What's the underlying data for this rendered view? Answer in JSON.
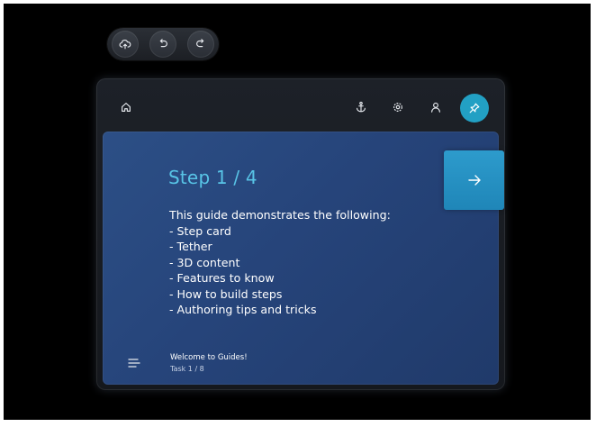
{
  "toolbar": {
    "buttons": [
      {
        "name": "cloud-upload",
        "icon": "cloud-upload-icon"
      },
      {
        "name": "undo",
        "icon": "undo-icon"
      },
      {
        "name": "redo",
        "icon": "redo-icon"
      }
    ]
  },
  "header": {
    "left_icon": "home-icon",
    "right_icons": [
      "anchor-icon",
      "settings-icon",
      "profile-icon"
    ],
    "pin_icon": "pin-icon",
    "accent_color": "#22a0c4"
  },
  "step": {
    "title": "Step 1 / 4",
    "body_lines": [
      "This guide demonstrates the following:",
      "- Step card",
      "- Tether",
      "- 3D content",
      "- Features to know",
      "- How to build steps",
      "- Authoring tips and tricks"
    ],
    "next_icon": "arrow-right-icon"
  },
  "footer": {
    "menu_icon": "list-icon",
    "title": "Welcome to Guides!",
    "task": "Task 1 / 8"
  },
  "colors": {
    "background": "#000000",
    "card": "#2a4a80",
    "title": "#58c4e6",
    "next_button": "#2693c4"
  }
}
